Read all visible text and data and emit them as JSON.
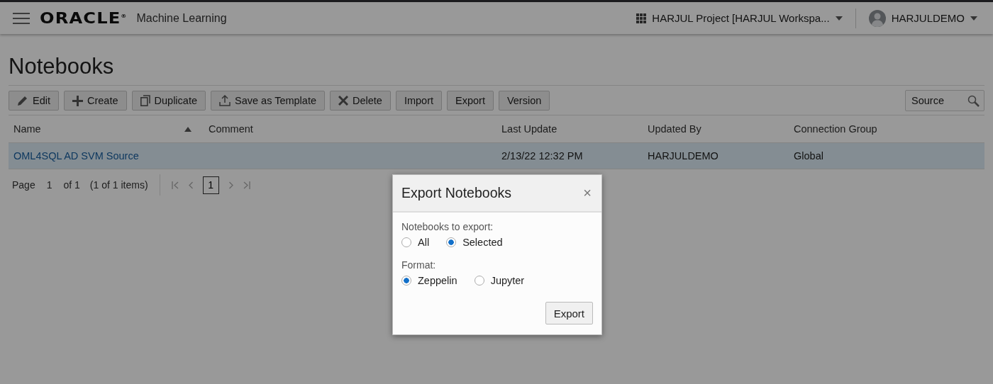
{
  "header": {
    "logo": "ORACLE",
    "logo_mark": "®",
    "product": "Machine Learning",
    "project": "HARJUL Project [HARJUL Workspa...",
    "user": "HARJULDEMO"
  },
  "page_title": "Notebooks",
  "toolbar": [
    "Edit",
    "Create",
    "Duplicate",
    "Save as Template",
    "Delete",
    "Import",
    "Export",
    "Version"
  ],
  "search": {
    "value": "Source"
  },
  "table": {
    "columns": [
      {
        "label": "Name",
        "sorted": true
      },
      {
        "label": "Comment",
        "sorted": false
      },
      {
        "label": "Last Update",
        "sorted": false
      },
      {
        "label": "Updated By",
        "sorted": false
      },
      {
        "label": "Connection Group",
        "sorted": false
      }
    ],
    "rows": [
      {
        "selected": true,
        "cells": [
          "OML4SQL AD SVM Source",
          "",
          "2/13/22 12:32 PM",
          "HARJULDEMO",
          "Global"
        ]
      }
    ]
  },
  "pagination": {
    "page_label": "Page",
    "page": "1",
    "of": "of 1",
    "items": "(1 of 1 items)",
    "current": "1"
  },
  "dialog": {
    "title": "Export Notebooks",
    "close": "×",
    "groups": [
      {
        "label": "Notebooks to export:",
        "options": [
          {
            "label": "All",
            "selected": false
          },
          {
            "label": "Selected",
            "selected": true
          }
        ]
      },
      {
        "label": "Format:",
        "options": [
          {
            "label": "Zeppelin",
            "selected": true
          },
          {
            "label": "Jupyter",
            "selected": false
          }
        ]
      }
    ],
    "button": "Export"
  }
}
